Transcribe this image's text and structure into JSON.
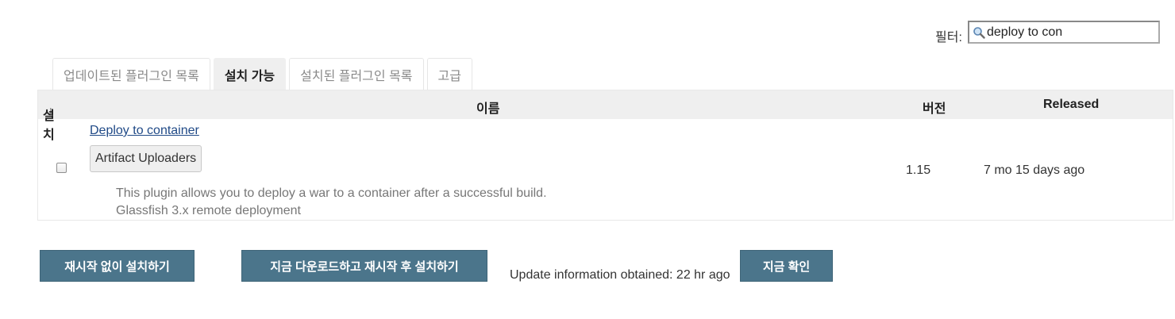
{
  "filter": {
    "label": "필터:",
    "value": "deploy to con",
    "icon": "search-icon"
  },
  "tabs": [
    {
      "label": "업데이트된 플러그인 목록",
      "active": false
    },
    {
      "label": "설치 가능",
      "active": true
    },
    {
      "label": "설치된 플러그인 목록",
      "active": false
    },
    {
      "label": "고급",
      "active": false
    }
  ],
  "table": {
    "headers": {
      "install": "설치",
      "sort_indicator": "↓",
      "name": "이름",
      "version": "버전",
      "released": "Released"
    },
    "rows": [
      {
        "checked": false,
        "name": "Deploy to container",
        "category": "Artifact Uploaders",
        "description_lines": [
          "This plugin allows you to deploy a war to a container after a successful build.",
          "Glassfish 3.x remote deployment"
        ],
        "version": "1.15",
        "released": "7 mo 15 days ago"
      }
    ]
  },
  "actions": {
    "install_without_restart": "재시작 없이 설치하기",
    "download_and_install_after_restart": "지금 다운로드하고 재시작 후 설치하기",
    "update_info": "Update information obtained: 22 hr ago",
    "check_now": "지금 확인"
  },
  "colors": {
    "button_bg": "#4b758b",
    "link": "#204a87",
    "header_bg": "#efefef"
  }
}
